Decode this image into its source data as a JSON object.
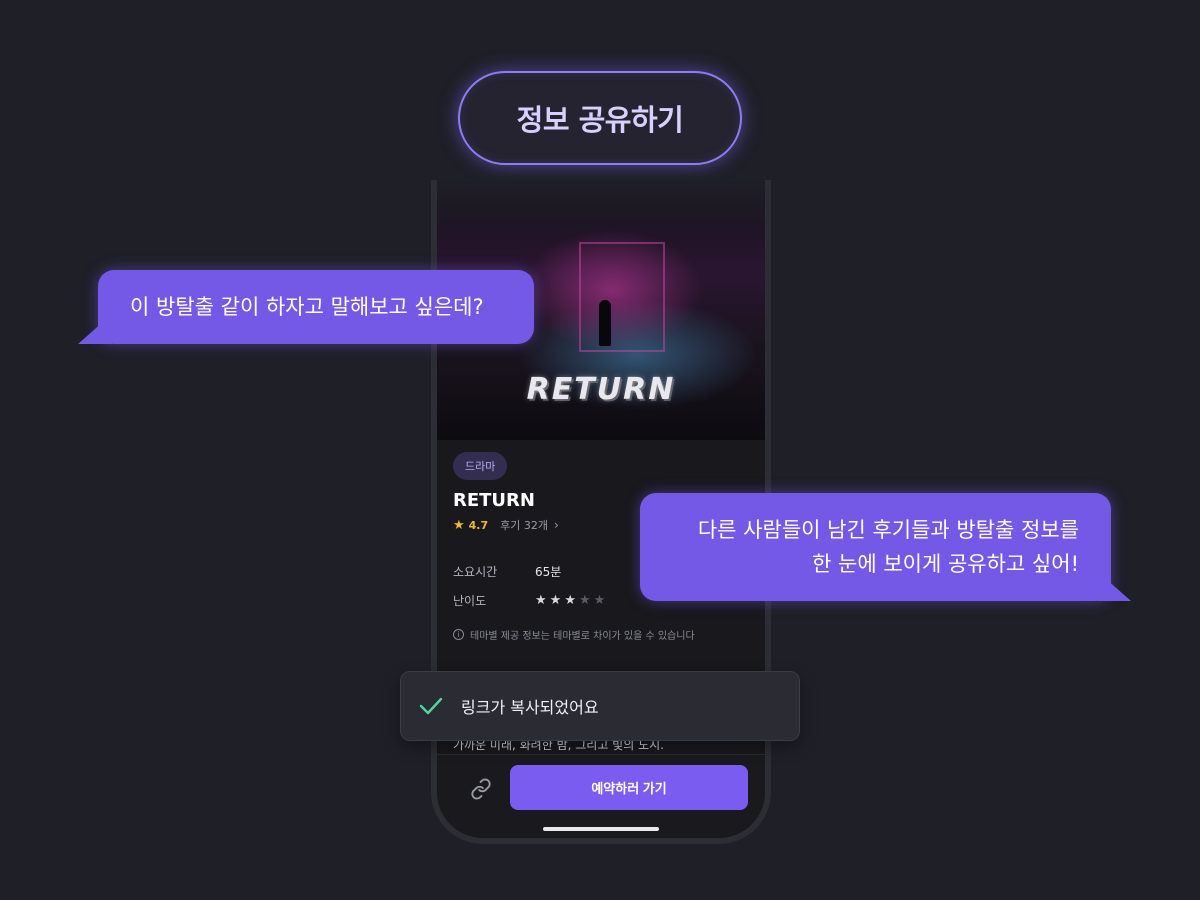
{
  "header": {
    "title": "정보 공유하기"
  },
  "poster": {
    "title_art": "RETURN"
  },
  "theme": {
    "genre": "드라마",
    "title": "RETURN",
    "rating": "4.7",
    "reviews_label": "후기 32개",
    "info": [
      {
        "label": "소요시간",
        "value": "65분"
      },
      {
        "label": "난이도",
        "difficulty_stars": 3,
        "max_stars": 5
      }
    ],
    "notice": "테마별 제공 정보는 테마별로 차이가 있을 수 있습니다",
    "description": "가까운 미래, 화려한 밤, 그리고 빛의 도시."
  },
  "bottom_bar": {
    "reserve_label": "예약하러 가기",
    "link_icon": "link-icon"
  },
  "bubbles": {
    "left": "이 방탈출 같이 하자고 말해보고 싶은데?",
    "right_line1": "다른 사람들이 남긴 후기들과 방탈출 정보를",
    "right_line2": "한 눈에 보이게 공유하고 싶어!"
  },
  "toast": {
    "message": "링크가 복사되었어요",
    "icon": "check-icon"
  },
  "colors": {
    "accent": "#7a5cf0",
    "bubble": "#7459e6",
    "rating": "#f5b82e",
    "background": "#1f1f28"
  }
}
